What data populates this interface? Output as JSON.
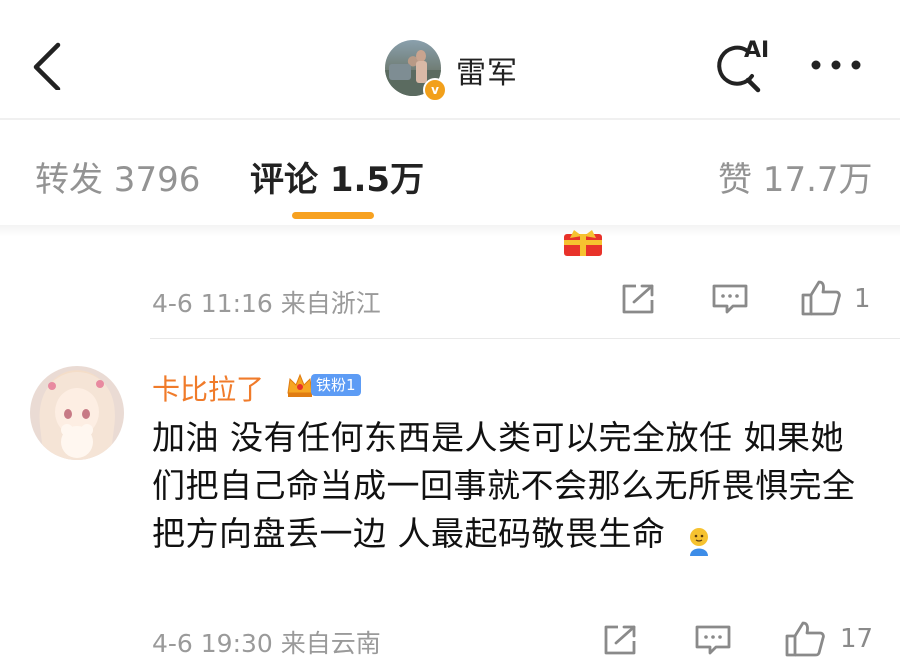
{
  "header": {
    "user_name": "雷军",
    "ai_label": "AI",
    "verified_mark": "v"
  },
  "tabs": [
    {
      "label": "转发 3796"
    },
    {
      "label": "评论 1.5万"
    },
    {
      "label": "赞 17.7万"
    }
  ],
  "active_tab": "评论 1.5万",
  "comments": [
    {
      "meta": "4-6 11:16 来自浙江",
      "like_count": "1"
    },
    {
      "author": "卡比拉了",
      "fan_badge": "铁粉1",
      "text": "加油 没有任何东西是人类可以完全放任  如果她们把自己命当成一回事就不会那么无所畏惧完全把方向盘丢一边   人最起码敬畏生命",
      "meta": "4-6 19:30 来自云南",
      "like_count": "17"
    }
  ],
  "colors": {
    "accent": "#f7a120",
    "author": "#f07b2a",
    "muted": "#939393"
  },
  "icons": [
    "back-arrow-icon",
    "ai-search-icon",
    "more-dots-icon",
    "share-icon",
    "reply-icon",
    "thumbs-up-icon",
    "gift-icon",
    "crown-icon",
    "emoji-icon",
    "verified-icon"
  ]
}
